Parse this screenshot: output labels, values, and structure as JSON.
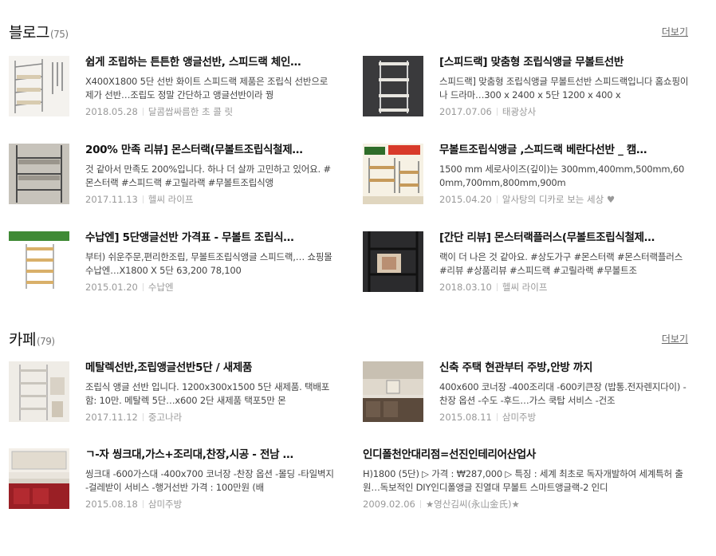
{
  "blog": {
    "title": "블로그",
    "count": "(75)",
    "more": "더보기",
    "items": [
      {
        "title": "쉽게 조립하는 튼튼한 앵글선반, 스피드랙 체인…",
        "desc": "X400X1800 5단 선반 화이트 스피드랙 제품은 조립식 선반으로 제가 선반…조립도 정말 간단하고 앵글선반이라 꿩",
        "date": "2018.05.28",
        "source": "달콤쌉싸름한 초 콜 릿"
      },
      {
        "title": "[스피드랙] 맞춤형 조립식앵글 무볼트선반",
        "desc": "스피드랙] 맞춤형 조립식앵글 무볼트선반 스피드랙입니다 홈쇼핑이나 드라마…300 x 2400 x 5단 1200 x 400 x",
        "date": "2017.07.06",
        "source": "태광상사"
      },
      {
        "title": "200% 만족 리뷰] 몬스터랙(무볼트조립식철제…",
        "desc": "것 같아서 만족도 200%입니다. 하나 더 살까 고민하고 있어요. #몬스터랙 #스피드랙 #고릴라랙 #무볼트조립식앵",
        "date": "2017.11.13",
        "source": "헬씨 라이프"
      },
      {
        "title": "무볼트조립식앵글 ,스피드랙 베란다선반 _ 캠…",
        "desc": "1500 mm 세로사이즈(깊이)는 300mm,400mm,500mm,600mm,700mm,800mm,900m",
        "date": "2015.04.20",
        "source": "알사탕의 디카로 보는 세상 ♥"
      },
      {
        "title": "수납엔] 5단앵글선반 가격표 - 무볼트 조립식…",
        "desc": "부터) 쉬운주문,편리한조립, 무볼트조립식앵글 스피드랙,… 쇼핑몰 수납엔…X1800 X 5단 63,200 78,100",
        "date": "2015.01.20",
        "source": "수납엔"
      },
      {
        "title": "[간단 리뷰] 몬스터랙플러스(무볼트조립식철제…",
        "desc": "랙이 더 나은 것 같아요. #상도가구 #몬스터랙 #몬스터랙플러스 #리뷰 #상품리뷰 #스피드랙 #고릴라랙 #무볼트조",
        "date": "2018.03.10",
        "source": "헬씨 라이프"
      }
    ]
  },
  "cafe": {
    "title": "카페",
    "count": "(79)",
    "more": "더보기",
    "items": [
      {
        "title": "메탈렉선반,조립앵글선반5단 / 새제품",
        "desc": "조립식 앵글 선반 입니다. 1200x300x1500 5단 새제품. 택배포함: 10만. 메탈렉 5단…x600 2단 새제품 택포5만 몬",
        "date": "2017.11.12",
        "source": "중고나라"
      },
      {
        "title": "신축 주택 현관부터 주방,안방 까지",
        "desc": "400x600 코너장 -400조리대 -600키큰장 (밥통.전자렌지다이) -찬장 옵션 -수도 -후드…가스 쿡탑 서비스 -건조",
        "date": "2015.08.11",
        "source": "삼미주방"
      },
      {
        "title": "ㄱ-자 씽크대,가스+조리대,찬장,시공 - 전남 …",
        "desc": "씽크대 -600가스대 -400x700 코너장 -찬장 옵션 -몰딩 -타일벽지 -걸레받이 서비스 -행거선반 가격 : 100만원 (배",
        "date": "2015.08.18",
        "source": "삼미주방"
      },
      {
        "title": "인디폴천안대리점=선진인테리어산업사",
        "desc": "H)1800 (5단) ▷ 가격 : ₩287,000 ▷ 특징 : 세계 최초로 독자개발하여 세계특허 출원…독보적인 DIY인디폴앵글 진열대 무볼트 스마트앵글랙-2 인디",
        "date": "2009.02.06",
        "source": "★영산김씨(永山金氏)★"
      }
    ]
  }
}
